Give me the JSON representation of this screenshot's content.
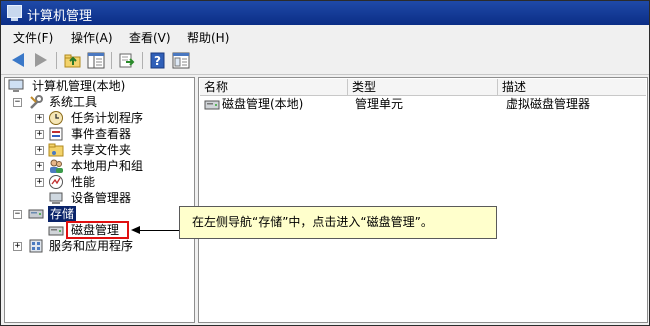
{
  "window": {
    "title": "计算机管理"
  },
  "menu": [
    "文件(F)",
    "操作(A)",
    "查看(V)",
    "帮助(H)"
  ],
  "toolbar": {
    "buttons": [
      "back-icon",
      "forward-icon",
      "up-folder-icon",
      "show-hide-tree-icon",
      "export-list-icon",
      "help-icon",
      "properties-icon"
    ]
  },
  "tree": {
    "root": "计算机管理(本地)",
    "system_tools": "系统工具",
    "task_scheduler": "任务计划程序",
    "event_viewer": "事件查看器",
    "shared_folders": "共享文件夹",
    "local_users": "本地用户和组",
    "performance": "性能",
    "device_manager": "设备管理器",
    "storage": "存储",
    "disk_management": "磁盘管理",
    "services_apps": "服务和应用程序"
  },
  "list": {
    "columns": [
      "名称",
      "类型",
      "描述"
    ],
    "rows": [
      {
        "name": "磁盘管理(本地)",
        "type": "管理单元",
        "desc": "虚拟磁盘管理器"
      }
    ]
  },
  "annotation": {
    "text": "在左侧导航“存储”中，点击进入“磁盘管理”。"
  },
  "colors": {
    "titlebar": "#0b2d86",
    "selection": "#0a246a",
    "highlight_box": "#e01010",
    "callout_bg": "#ffffcc"
  }
}
